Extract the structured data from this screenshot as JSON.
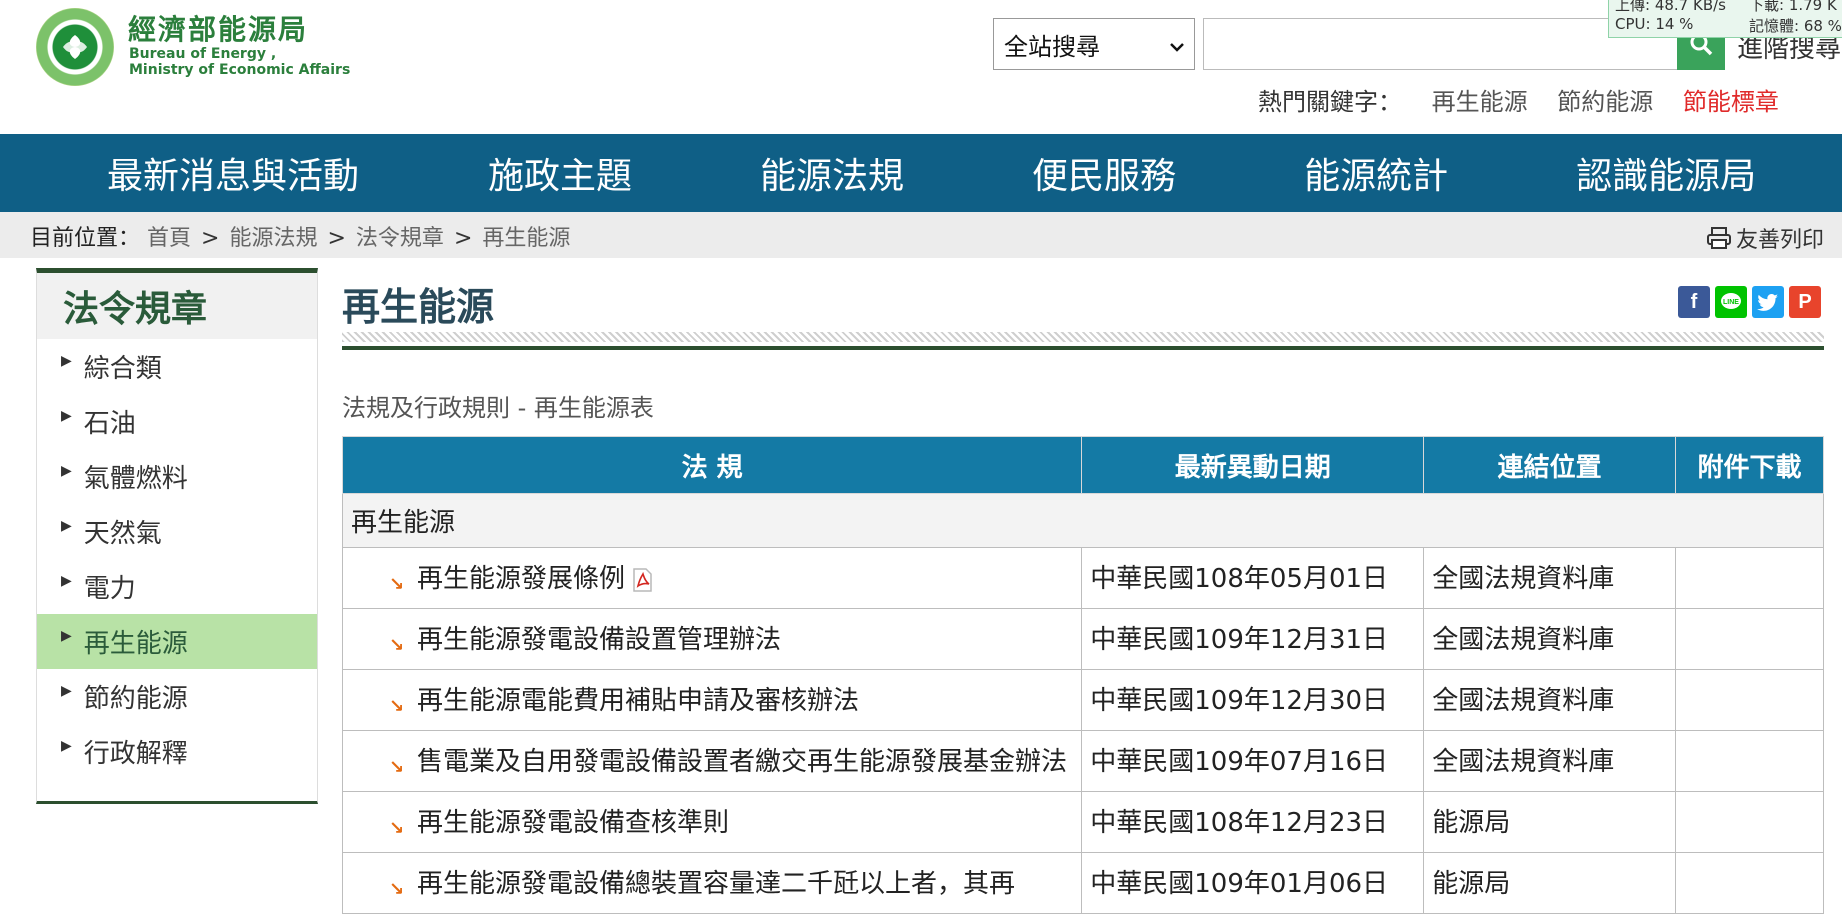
{
  "header": {
    "logo_title": "經濟部能源局",
    "logo_sub_line1": "Bureau of Energy ,",
    "logo_sub_line2": "Ministry of Economic Affairs",
    "search_scope": "全站搜尋",
    "search_placeholder": "",
    "advanced_search": "進階搜尋",
    "hot_label": "熱門關鍵字：",
    "hot_keywords": [
      "再生能源",
      "節約能源",
      "節能標章"
    ],
    "system_monitor": {
      "upload": "上傳: 48.7 KB/s",
      "download": "下載: 1.79 K",
      "cpu": "CPU: 14 %",
      "memory": "記憶體: 68 %"
    }
  },
  "nav": {
    "items": [
      "最新消息與活動",
      "施政主題",
      "能源法規",
      "便民服務",
      "能源統計",
      "認識能源局"
    ]
  },
  "breadcrumb": {
    "label": "目前位置：",
    "items": [
      "首頁",
      "能源法規",
      "法令規章",
      "再生能源"
    ],
    "print": "友善列印"
  },
  "sidebar": {
    "title": "法令規章",
    "items": [
      "綜合類",
      "石油",
      "氣體燃料",
      "天然氣",
      "電力",
      "再生能源",
      "節約能源",
      "行政解釋"
    ],
    "active_index": 5
  },
  "main": {
    "title": "再生能源",
    "subtitle": "法規及行政規則 - 再生能源表",
    "share": [
      "facebook-icon",
      "line-icon",
      "twitter-icon",
      "plurk-icon"
    ],
    "table": {
      "headers": [
        "法 規",
        "最新異動日期",
        "連結位置",
        "附件下載"
      ],
      "group": "再生能源",
      "rows": [
        {
          "name": "再生能源發展條例",
          "date": "中華民國108年05月01日",
          "location": "全國法規資料庫",
          "pdf": true
        },
        {
          "name": "再生能源發電設備設置管理辦法",
          "date": "中華民國109年12月31日",
          "location": "全國法規資料庫"
        },
        {
          "name": "再生能源電能費用補貼申請及審核辦法",
          "date": "中華民國109年12月30日",
          "location": "全國法規資料庫"
        },
        {
          "name": "售電業及自用發電設備設置者繳交再生能源發展基金辦法",
          "date": "中華民國109年07月16日",
          "location": "全國法規資料庫"
        },
        {
          "name": "再生能源發電設備查核準則",
          "date": "中華民國108年12月23日",
          "location": "能源局"
        },
        {
          "name": "再生能源發電設備總裝置容量達二千瓩以上者，其再",
          "date": "中華民國109年01月06日",
          "location": "能源局"
        }
      ]
    }
  },
  "colors": {
    "nav_bg": "#0f5f86",
    "table_header_bg": "#147aa5",
    "sidebar_active": "#b8e2a6",
    "brand_green": "#2b7f3c",
    "hot_highlight": "#e02a2a"
  }
}
